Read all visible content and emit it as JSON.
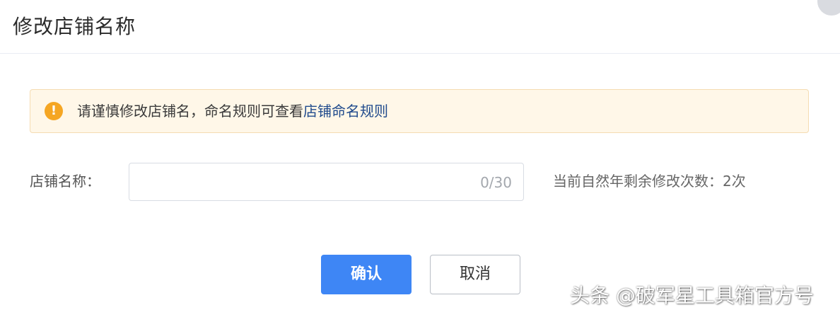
{
  "dialog": {
    "title": "修改店铺名称"
  },
  "notice": {
    "icon": "warning-icon",
    "icon_glyph": "!",
    "text": "请谨慎修改店铺名，命名规则可查看",
    "link_text": "店铺命名规则",
    "color_bg": "#fff7e8",
    "color_icon": "#f5a623",
    "color_link": "#1f4a8c"
  },
  "form": {
    "label": "店铺名称：",
    "input_value": "",
    "counter": "0/30",
    "remaining": "当前自然年剩余修改次数：2次"
  },
  "actions": {
    "confirm_label": "确认",
    "cancel_label": "取消",
    "confirm_color": "#3e86f5"
  },
  "watermark": {
    "text": "头条 @破军星工具箱官方号"
  }
}
